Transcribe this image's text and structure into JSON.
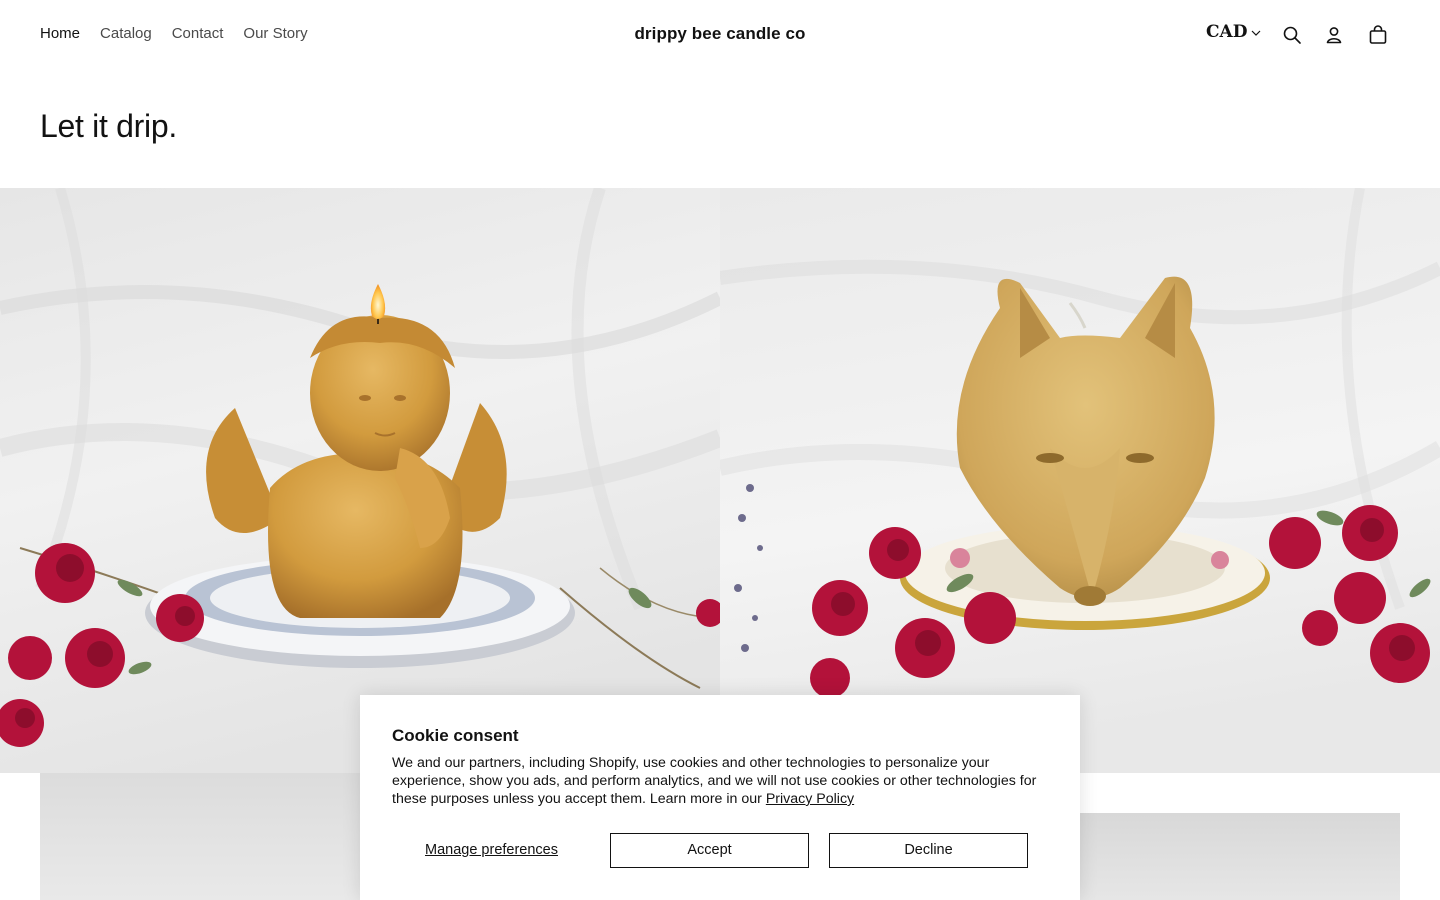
{
  "header": {
    "nav": [
      {
        "label": "Home",
        "active": true
      },
      {
        "label": "Catalog"
      },
      {
        "label": "Contact"
      },
      {
        "label": "Our Story"
      }
    ],
    "brand": "drippy bee candle co",
    "currency": "CAD",
    "icons": [
      "search-icon",
      "account-icon",
      "cart-icon",
      "chevron-down-icon"
    ]
  },
  "hero": {
    "heading": "Let it drip.",
    "images": [
      {
        "subject": "beeswax cherub candle with lit flame on saucer with red roses"
      },
      {
        "subject": "beeswax wolf head candle on floral saucer with red roses"
      }
    ]
  },
  "cookie": {
    "title": "Cookie consent",
    "body": "We and our partners, including Shopify, use cookies and other technologies to personalize your experience, show you ads, and perform analytics, and we will not use cookies or other technologies for these purposes unless you accept them. Learn more in our ",
    "link": "Privacy Policy",
    "manage": "Manage preferences",
    "accept": "Accept",
    "decline": "Decline"
  },
  "colors": {
    "text": "#121212",
    "muted": "#4a4a4a",
    "background": "#ffffff",
    "beeswax": "#d6a44a",
    "rose": "#b3123a"
  }
}
